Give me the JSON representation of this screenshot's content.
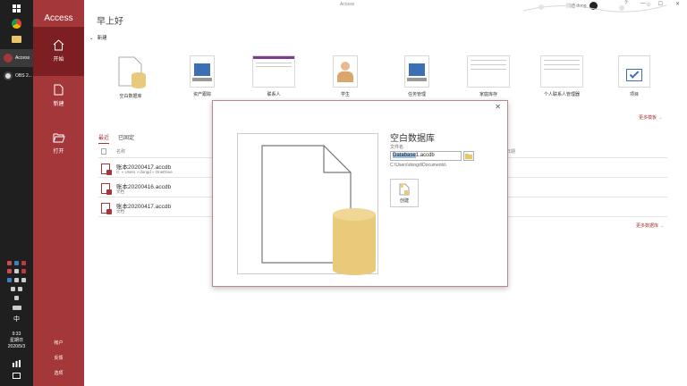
{
  "window": {
    "title": "Access",
    "account_name": "腾迪 dong",
    "controls": [
      "?",
      "—",
      "☐",
      "✕"
    ]
  },
  "taskbar": {
    "apps": [
      {
        "name": "Access",
        "color": "#a4373a"
      },
      {
        "name": "OBS 2...",
        "color": "#dddddd"
      }
    ],
    "ime": "中",
    "time": "9:33",
    "weekday": "星期日",
    "date": "2020/5/3"
  },
  "backstage": {
    "app_name": "Access",
    "nav": [
      {
        "label": "开始",
        "icon": "home-icon",
        "active": true
      },
      {
        "label": "新建",
        "icon": "new-document-icon",
        "active": false
      },
      {
        "label": "打开",
        "icon": "folder-open-icon",
        "active": false
      }
    ],
    "bottom": [
      "帐户",
      "反馈",
      "选项"
    ]
  },
  "main": {
    "greeting": "早上好",
    "new_section": "新建",
    "templates": [
      {
        "label": "空白数据库",
        "icon": "blank-database-icon"
      },
      {
        "label": "资产跟踪",
        "icon": "asset-tracking-thumbnail"
      },
      {
        "label": "联系人",
        "icon": "contacts-thumbnail"
      },
      {
        "label": "学生",
        "icon": "students-thumbnail"
      },
      {
        "label": "任务管理",
        "icon": "task-management-thumbnail"
      },
      {
        "label": "家庭库存",
        "icon": "home-inventory-thumbnail"
      },
      {
        "label": "个人联系人管理器",
        "icon": "personal-contacts-thumbnail"
      },
      {
        "label": "项目",
        "icon": "projects-thumbnail"
      }
    ],
    "more_templates": "更多模板",
    "tabs": [
      "最近",
      "已固定"
    ],
    "column_name": "名称",
    "column_date": "日期",
    "recent_files": [
      {
        "name": "账本20200417.accdb",
        "path": "C: » Users » dongd » OneDrive"
      },
      {
        "name": "账本20200416.accdb",
        "path": "文档"
      },
      {
        "name": "账本20200417.accdb",
        "path": "文档"
      }
    ],
    "more_databases": "更多数据库"
  },
  "dialog": {
    "title": "空白数据库",
    "filename_label": "文件名",
    "filename_selected": "Database",
    "filename_rest": "1.accdb",
    "path": "C:\\Users\\dongd\\Documents\\",
    "create_label": "创建",
    "close": "✕"
  },
  "colors": {
    "accent": "#a4373a",
    "accent_dark": "#7d1f22",
    "database_yellow": "#e9c97a"
  }
}
